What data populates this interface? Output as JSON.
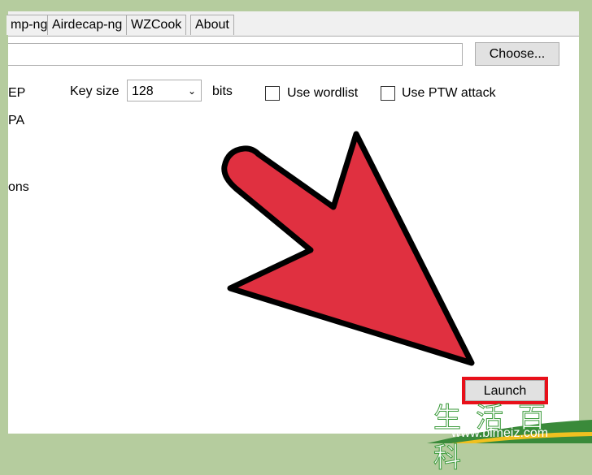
{
  "tabs": [
    {
      "label": "mp-ng"
    },
    {
      "label": "Airdecap-ng"
    },
    {
      "label": "WZCook"
    },
    {
      "label": "About"
    }
  ],
  "path_input": {
    "value": ""
  },
  "choose_button": "Choose...",
  "options": {
    "wep_label": "EP",
    "wpa_label": "PA",
    "options_label": "ons",
    "key_size_label": "Key size",
    "key_size_value": "128",
    "bits_label": "bits",
    "use_wordlist": "Use wordlist",
    "use_ptw": "Use PTW attack"
  },
  "launch_button": "Launch",
  "watermark": {
    "chars": "生活百科",
    "url": "www.bimeiz.com"
  },
  "colors": {
    "arrow": "#e03040",
    "highlight": "#e8101a",
    "background": "#b5cc9e"
  }
}
